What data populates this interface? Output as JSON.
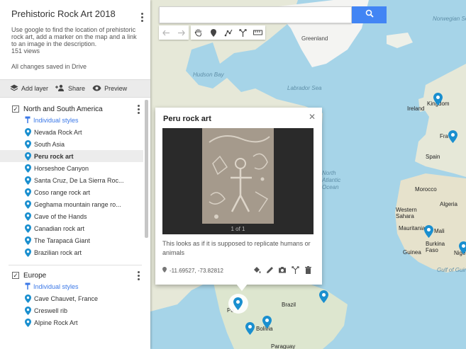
{
  "panel": {
    "title": "Prehistoric Rock Art 2018",
    "description": "Use google to find the location of prehistoric rock art, add a marker on the map and a link to an image in the description.",
    "views": "151 views",
    "save_status": "All changes saved in Drive",
    "actions": {
      "add_layer": "Add layer",
      "share": "Share",
      "preview": "Preview"
    },
    "layers": [
      {
        "name": "North and South America",
        "styles_label": "Individual styles",
        "items": [
          "Nevada Rock Art",
          "South Asia",
          "Peru rock art",
          "Horseshoe Canyon",
          "Santa Cruz, De La Sierra Roc...",
          "Coso range rock art",
          "Geghama mountain range ro...",
          "Cave of the Hands",
          "Canadian rock art",
          "The Tarapacá Giant",
          "Brazilian rock art"
        ],
        "selected_index": 2
      },
      {
        "name": "Europe",
        "styles_label": "Individual styles",
        "items": [
          "Cave Chauvet, France",
          "Creswell rib",
          "Alpine Rock Art"
        ]
      }
    ]
  },
  "info_card": {
    "title": "Peru rock art",
    "image_counter": "1 of 1",
    "description": "This looks as if it is supposed to replicate humans or animals",
    "coordinates": "-11.69527, -73.82812"
  },
  "map_labels": {
    "greenland": "Greenland",
    "hudson_bay": "Hudson Bay",
    "labrador_sea": "Labrador Sea",
    "norwegian_sea": "Norwegian Sea",
    "ireland": "Ireland",
    "kingdom": "Kingdom",
    "spain": "Spain",
    "fra": "Fra",
    "morocco": "Morocco",
    "algeria": "Algeria",
    "western_sahara": "Western Sahara",
    "mauritania": "Mauritania",
    "mali": "Mali",
    "burkina_faso": "Burkina Faso",
    "guinea": "Guinea",
    "nige": "Nige",
    "gulf_of_guinea": "Gulf of Guinea",
    "north_atlantic_ocean": "North Atlantic Ocean",
    "brazil": "Brazil",
    "bolivia": "Bolivia",
    "paraguay": "Paraguay",
    "peru_short": "Pe"
  },
  "colors": {
    "accent": "#4285f4",
    "pin": "#1a8fcf",
    "link": "#3b78e7",
    "land": "#e8eadf",
    "water": "#a6d4e8"
  }
}
